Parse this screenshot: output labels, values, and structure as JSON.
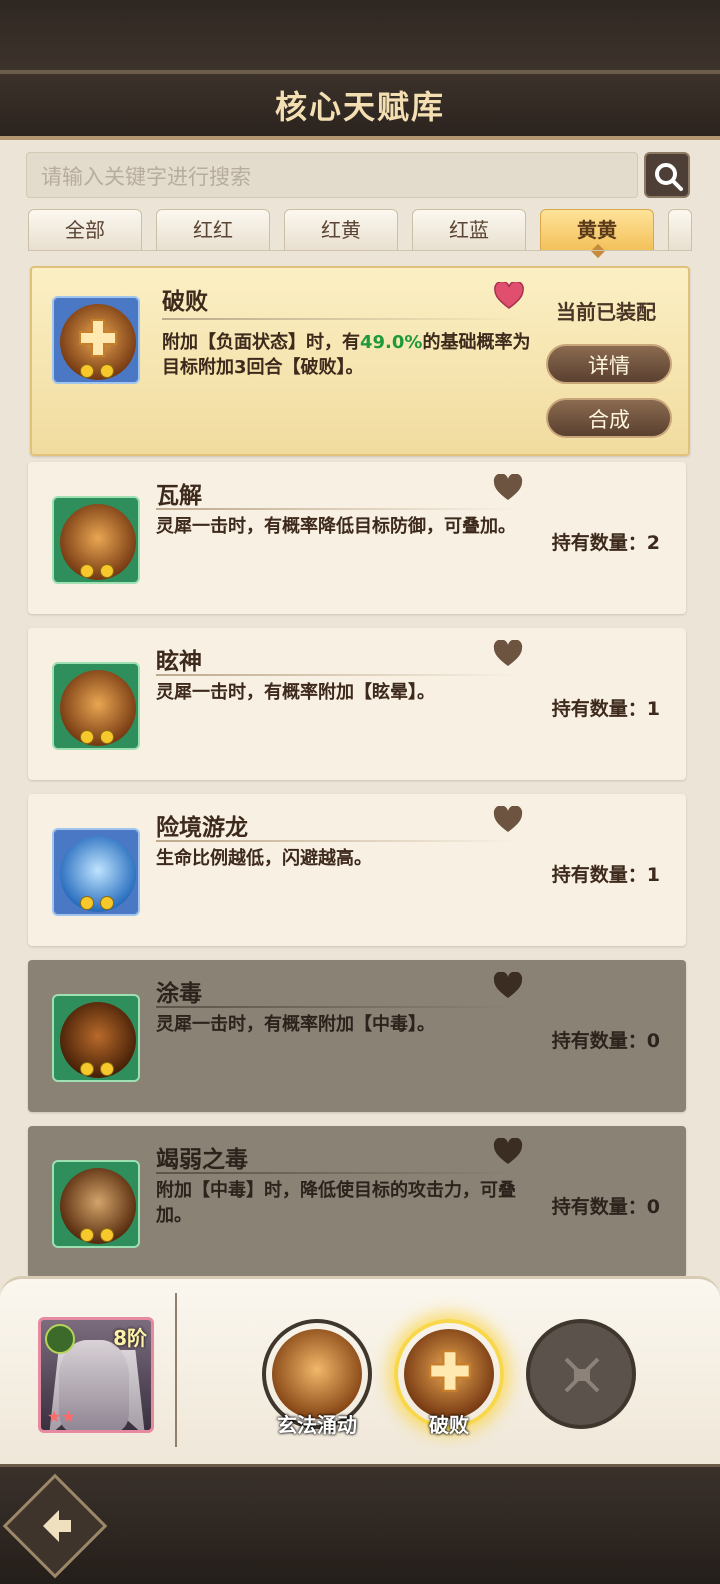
{
  "header": {
    "title": "核心天赋库"
  },
  "search": {
    "placeholder": "请输入关键字进行搜索"
  },
  "tabs": [
    {
      "label": "全部"
    },
    {
      "label": "红红"
    },
    {
      "label": "红黄"
    },
    {
      "label": "红蓝"
    },
    {
      "label": "黄黄",
      "active": true
    }
  ],
  "talents": [
    {
      "name": "破败",
      "desc_part1": "附加【负面状态】时，有",
      "desc_highlight": "49.0%",
      "desc_part2": "的基础概率为目标附加3回合【破败】。",
      "favorited": true,
      "status": "当前已装配",
      "detail_label": "详情",
      "combine_label": "合成",
      "frame": "blue",
      "heart_color": "#e0506e"
    },
    {
      "name": "瓦解",
      "desc": "灵犀一击时，有概率降低目标防御，可叠加。",
      "count_label": "持有数量：2",
      "frame": "green"
    },
    {
      "name": "眩神",
      "desc": "灵犀一击时，有概率附加【眩晕】。",
      "count_label": "持有数量：1",
      "frame": "green"
    },
    {
      "name": "险境游龙",
      "desc": "生命比例越低，闪避越高。",
      "count_label": "持有数量：1",
      "frame": "blue"
    },
    {
      "name": "涂毒",
      "desc": "灵犀一击时，有概率附加【中毒】。",
      "count_label": "持有数量：0",
      "frame": "green",
      "dim": true
    },
    {
      "name": "竭弱之毒",
      "desc": "附加【中毒】时，降低使目标的攻击力，可叠加。",
      "count_label": "持有数量：0",
      "frame": "green",
      "dim": true
    }
  ],
  "equip_panel": {
    "hero": {
      "rank": "8阶",
      "stars": "★★"
    },
    "slots": [
      {
        "label": "玄法涌动"
      },
      {
        "label": "破败",
        "selected": true
      },
      {
        "label": "",
        "locked": true
      }
    ]
  },
  "colors": {
    "accent_gold": "#f3c15a",
    "highlight_green": "#1f9a3a",
    "heart_inactive": "#6d5440"
  }
}
